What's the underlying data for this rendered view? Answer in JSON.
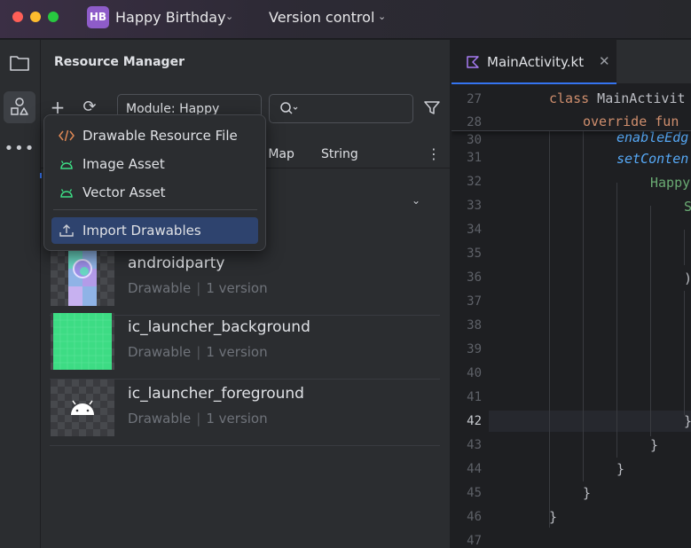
{
  "window": {
    "project_initials": "HB",
    "project_name": "Happy Birthday",
    "version_control": "Version control"
  },
  "toolstrip": {
    "items": [
      {
        "name": "project-tool",
        "icon": "folder-icon"
      },
      {
        "name": "resource-manager-tool",
        "icon": "shapes-icon",
        "active": true
      },
      {
        "name": "more-tools",
        "icon": "more-icon"
      }
    ]
  },
  "resource_manager": {
    "title": "Resource Manager",
    "module_select": "Module: Happy",
    "tabs": [
      "p Map",
      "String"
    ],
    "menu": {
      "items": [
        {
          "label": "Drawable Resource File",
          "icon": "code-file-icon"
        },
        {
          "label": "Image Asset",
          "icon": "android-icon"
        },
        {
          "label": "Vector Asset",
          "icon": "android-icon"
        },
        {
          "label": "Import Drawables",
          "icon": "upload-icon",
          "active": true
        }
      ]
    },
    "resources": [
      {
        "name": "androidparty",
        "type": "Drawable",
        "versions": "1 version"
      },
      {
        "name": "ic_launcher_background",
        "type": "Drawable",
        "versions": "1 version"
      },
      {
        "name": "ic_launcher_foreground",
        "type": "Drawable",
        "versions": "1 version"
      }
    ]
  },
  "editor": {
    "tab_label": "MainActivity.kt",
    "line_numbers": [
      "27",
      "28",
      "30",
      "31",
      "32",
      "33",
      "34",
      "35",
      "36",
      "37",
      "38",
      "39",
      "40",
      "41",
      "42",
      "43",
      "44",
      "45",
      "46",
      "47"
    ],
    "current_line": "42",
    "sticky_lines": [
      {
        "kw": "class",
        "rest": " MainActivit"
      },
      {
        "kw": "override fun",
        "rest": ""
      }
    ],
    "code": {
      "l30": "enableEdg",
      "l31": "setConten",
      "l32": "Happy",
      "l33": "S",
      "l36": ")",
      "l42": "}",
      "l43": "}",
      "l44": "}",
      "l45": "}",
      "l46": "}"
    }
  },
  "colors": {
    "accent": "#3574f0",
    "menu_active": "#2e436e",
    "android_green": "#3ddc84",
    "project_badge": "#8e5cc9"
  }
}
